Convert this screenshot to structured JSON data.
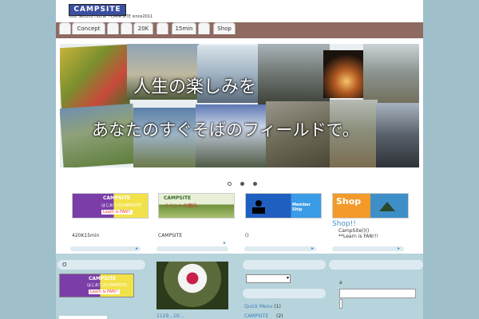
{
  "header": {
    "logo_text": "CAMPSITE",
    "logo_sub": "Your Second Home    ~CAMPSITE since2011"
  },
  "nav": {
    "tabs": [
      {
        "label": ""
      },
      {
        "label": "Concept"
      },
      {
        "label": ""
      },
      {
        "label": ""
      },
      {
        "label": "20K"
      },
      {
        "label": ""
      },
      {
        "label": "15min"
      },
      {
        "label": ""
      },
      {
        "label": "Shop"
      }
    ]
  },
  "slider": {
    "line1": "人生の楽しみを",
    "line2": "あなたのすぐそばのフィールドで。",
    "dot_count": 3,
    "active_dot": 0
  },
  "banners": [
    {
      "image_text": "CAMPSITE",
      "image_sub": "はじめてのCAMPSITE",
      "image_tag": "Learn is FAN!!",
      "caption": "420K15min",
      "title": "",
      "desc": ""
    },
    {
      "image_text": "CAMPSITE",
      "image_sub": "イベントの案内",
      "image_tag": "",
      "caption": "CAMPSITE",
      "title": "",
      "desc": ""
    },
    {
      "image_text": "Member Ship",
      "image_sub": "",
      "image_tag": "",
      "caption": "()",
      "title": "",
      "desc": ""
    },
    {
      "image_text": "Shop",
      "image_sub": "",
      "image_tag": "",
      "caption": "",
      "title": "Shop!!",
      "desc": "CampSite()()\n**Learn is FAN!!!"
    }
  ],
  "bottom": {
    "col1_head": "O",
    "col1_banner_text": "CAMPSITE",
    "col1_banner_sub": "はじめてのCAMPSITE",
    "col1_banner_tag": "Learn is FAN!!",
    "col2_caption": "1129...10...",
    "col3_links": [
      {
        "label": "Quick Menu",
        "count": "(1)"
      },
      {
        "label": "CAMPSITE",
        "count": "(2)"
      }
    ],
    "col4_label": "a"
  },
  "colors": {
    "background": "#9fbfca",
    "navbar": "#8e6a61",
    "link": "#3d7fb5"
  }
}
